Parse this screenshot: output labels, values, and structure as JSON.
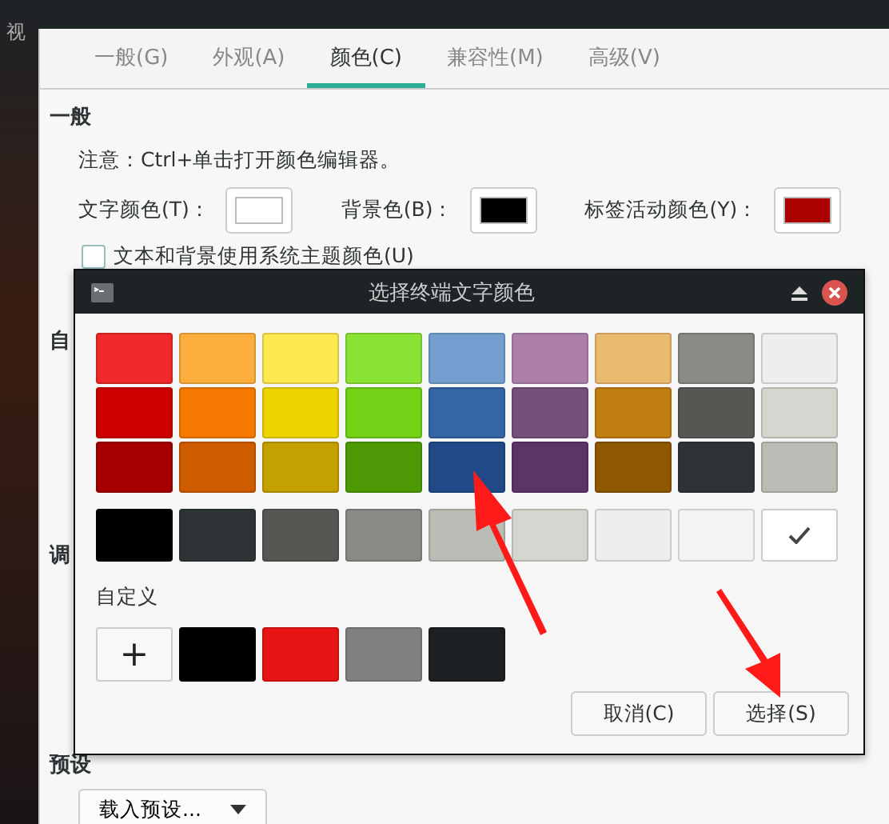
{
  "side_label": "视",
  "tabs": [
    {
      "label": "一般(G)",
      "selected": false
    },
    {
      "label": "外观(A)",
      "selected": false
    },
    {
      "label": "颜色(C)",
      "selected": true
    },
    {
      "label": "兼容性(M)",
      "selected": false
    },
    {
      "label": "高级(V)",
      "selected": false
    }
  ],
  "general": {
    "heading": "一般",
    "note": "注意：Ctrl+单击打开颜色编辑器。",
    "colors": [
      {
        "label": "文字颜色(T)：",
        "color": "#ffffff"
      },
      {
        "label": "背景色(B)：",
        "color": "#000000"
      },
      {
        "label": "标签活动颜色(Y)：",
        "color": "#aa0000"
      }
    ],
    "checkbox": {
      "label": "文本和背景使用系统主题颜色(U)",
      "checked": false
    }
  },
  "custom_heading": "自",
  "palette_heading": "调",
  "presets": {
    "heading": "预设",
    "dropdown": "载入预设..."
  },
  "dialog": {
    "title": "选择终端文字颜色",
    "palette": [
      [
        {
          "color": "#ef2929"
        },
        {
          "color": "#fcaf3e"
        },
        {
          "color": "#fce94f"
        },
        {
          "color": "#8ae234"
        },
        {
          "color": "#729fcf"
        },
        {
          "color": "#ad7fa8"
        },
        {
          "color": "#e9b96e"
        },
        {
          "color": "#888a85"
        },
        {
          "color": "#eeeeec"
        }
      ],
      [
        {
          "color": "#cc0000"
        },
        {
          "color": "#f57900"
        },
        {
          "color": "#edd400"
        },
        {
          "color": "#73d216"
        },
        {
          "color": "#3465a4"
        },
        {
          "color": "#75507b"
        },
        {
          "color": "#c17d11"
        },
        {
          "color": "#555753"
        },
        {
          "color": "#d3d7cf"
        }
      ],
      [
        {
          "color": "#a40000"
        },
        {
          "color": "#ce5c00"
        },
        {
          "color": "#c4a000"
        },
        {
          "color": "#4e9a06"
        },
        {
          "color": "#204a87"
        },
        {
          "color": "#5c3566"
        },
        {
          "color": "#8f5902"
        },
        {
          "color": "#2e3436"
        },
        {
          "color": "#babdb6"
        }
      ]
    ],
    "grays": [
      {
        "color": "#000000",
        "selected": false
      },
      {
        "color": "#2e3436",
        "selected": false
      },
      {
        "color": "#555753",
        "selected": false
      },
      {
        "color": "#888a85",
        "selected": false
      },
      {
        "color": "#babdb6",
        "selected": false
      },
      {
        "color": "#d3d7cf",
        "selected": false
      },
      {
        "color": "#eeeeec",
        "selected": false
      },
      {
        "color": "#f3f3f3",
        "selected": false
      },
      {
        "color": "#ffffff",
        "selected": true
      }
    ],
    "custom_label": "自定义",
    "add_button": "+",
    "custom_colors": [
      {
        "color": "#000000"
      },
      {
        "color": "#e81313"
      },
      {
        "color": "#808080"
      },
      {
        "color": "#1c2022"
      }
    ],
    "buttons": [
      "取消(C)",
      "选择(S)"
    ]
  }
}
